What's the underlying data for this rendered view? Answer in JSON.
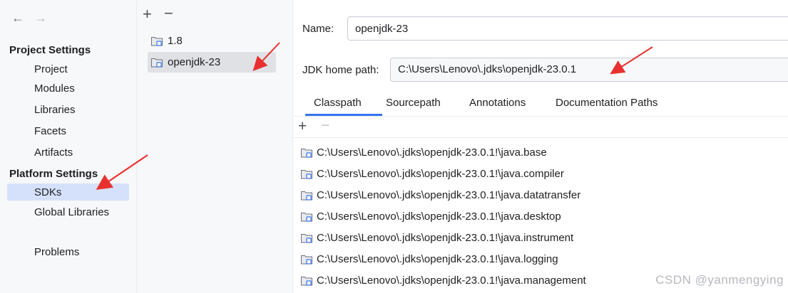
{
  "nav": {
    "back_icon": "arrow-left-icon",
    "forward_icon": "arrow-right-icon",
    "project_settings_title": "Project Settings",
    "project_items": [
      "Project",
      "Modules",
      "Libraries",
      "Facets",
      "Artifacts"
    ],
    "platform_settings_title": "Platform Settings",
    "platform_items": [
      "SDKs",
      "Global Libraries"
    ],
    "selected": "SDKs",
    "problems": "Problems"
  },
  "sdk_list": {
    "add_icon": "plus-icon",
    "remove_icon": "minus-icon",
    "items": [
      "1.8",
      "openjdk-23"
    ],
    "selected": "openjdk-23"
  },
  "details": {
    "name_label": "Name:",
    "name_value": "openjdk-23",
    "home_label": "JDK home path:",
    "home_value": "C:\\Users\\Lenovo\\.jdks\\openjdk-23.0.1",
    "tabs": [
      "Classpath",
      "Sourcepath",
      "Annotations",
      "Documentation Paths"
    ],
    "active_tab": "Classpath",
    "classpath": [
      "C:\\Users\\Lenovo\\.jdks\\openjdk-23.0.1!\\java.base",
      "C:\\Users\\Lenovo\\.jdks\\openjdk-23.0.1!\\java.compiler",
      "C:\\Users\\Lenovo\\.jdks\\openjdk-23.0.1!\\java.datatransfer",
      "C:\\Users\\Lenovo\\.jdks\\openjdk-23.0.1!\\java.desktop",
      "C:\\Users\\Lenovo\\.jdks\\openjdk-23.0.1!\\java.instrument",
      "C:\\Users\\Lenovo\\.jdks\\openjdk-23.0.1!\\java.logging",
      "C:\\Users\\Lenovo\\.jdks\\openjdk-23.0.1!\\java.management"
    ]
  },
  "watermark": "CSDN @yanmengying",
  "colors": {
    "accent": "#3574f0",
    "selection": "#d5e1fb",
    "annotation_arrow": "#e8312f"
  }
}
